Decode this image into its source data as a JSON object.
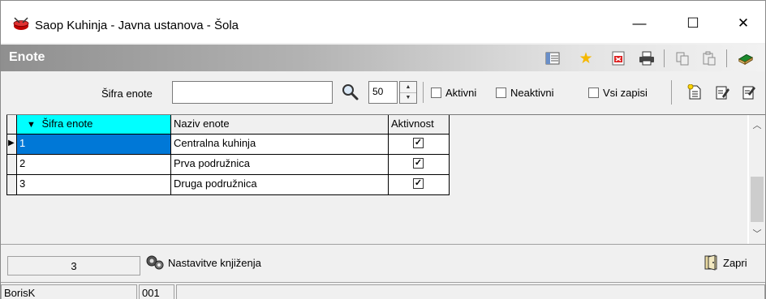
{
  "window": {
    "title": "Saop Kuhinja - Javna ustanova - Šola",
    "minimize_glyph": "—",
    "maximize_glyph": "☐",
    "close_glyph": "✕"
  },
  "header": {
    "title": "Enote",
    "icons": [
      "list-settings-icon",
      "star-icon",
      "export-pdf-icon",
      "print-icon",
      "copy-icon",
      "paste-icon",
      "help-book-icon"
    ]
  },
  "filter": {
    "sifra_label": "Šifra enote",
    "sifra_value": "",
    "count_value": "50",
    "aktivni_label": "Aktivni",
    "neaktivni_label": "Neaktivni",
    "vsi_label": "Vsi zapisi"
  },
  "grid": {
    "columns": [
      "Šifra enote",
      "Naziv enote",
      "Aktivnost"
    ],
    "sort_glyph": "▼",
    "rows": [
      {
        "sifra": "1",
        "naziv": "Centralna kuhinja",
        "aktivnost": true
      },
      {
        "sifra": "2",
        "naziv": "Prva podružnica",
        "aktivnost": true
      },
      {
        "sifra": "3",
        "naziv": "Druga podružnica",
        "aktivnost": true
      }
    ],
    "check_glyph": "✓",
    "current_row_glyph": "▶"
  },
  "footer": {
    "record_count": "3",
    "nastavitve_label": "Nastavitve knjiženja",
    "zapri_label": "Zapri"
  },
  "status": {
    "user": "BorisK",
    "code": "001",
    "message": ""
  },
  "colors": {
    "sorted_header": "#00ffff",
    "selection": "#0078d7"
  }
}
